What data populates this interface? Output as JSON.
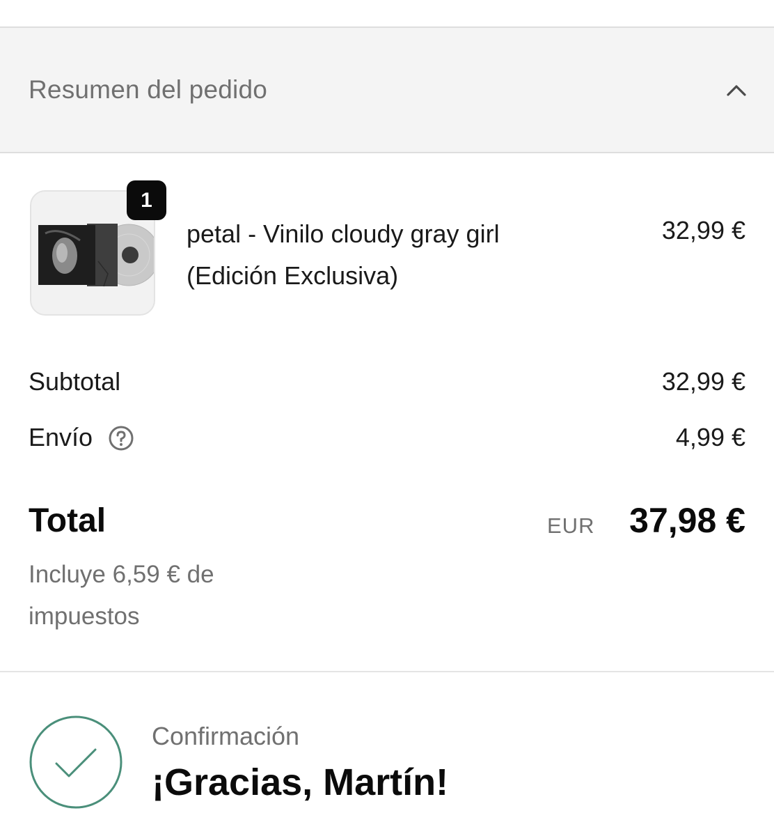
{
  "summary": {
    "title": "Resumen del pedido",
    "toggle_icon": "chevron-up-icon"
  },
  "product": {
    "quantity": "1",
    "name": "petal - Vinilo cloudy gray girl (Edición Exclusiva)",
    "price": "32,99 €"
  },
  "costs": {
    "subtotal_label": "Subtotal",
    "subtotal_value": "32,99 €",
    "shipping_label": "Envío",
    "shipping_value": "4,99 €",
    "shipping_help_icon": "question-circle-icon"
  },
  "total": {
    "label": "Total",
    "currency": "EUR",
    "amount": "37,98 €",
    "tax_note": "Incluye 6,59 € de impuestos"
  },
  "confirmation": {
    "subtitle": "Confirmación",
    "title": "¡Gracias, Martín!",
    "icon": "check-circle-icon",
    "accent_color": "#4a8f7a"
  }
}
